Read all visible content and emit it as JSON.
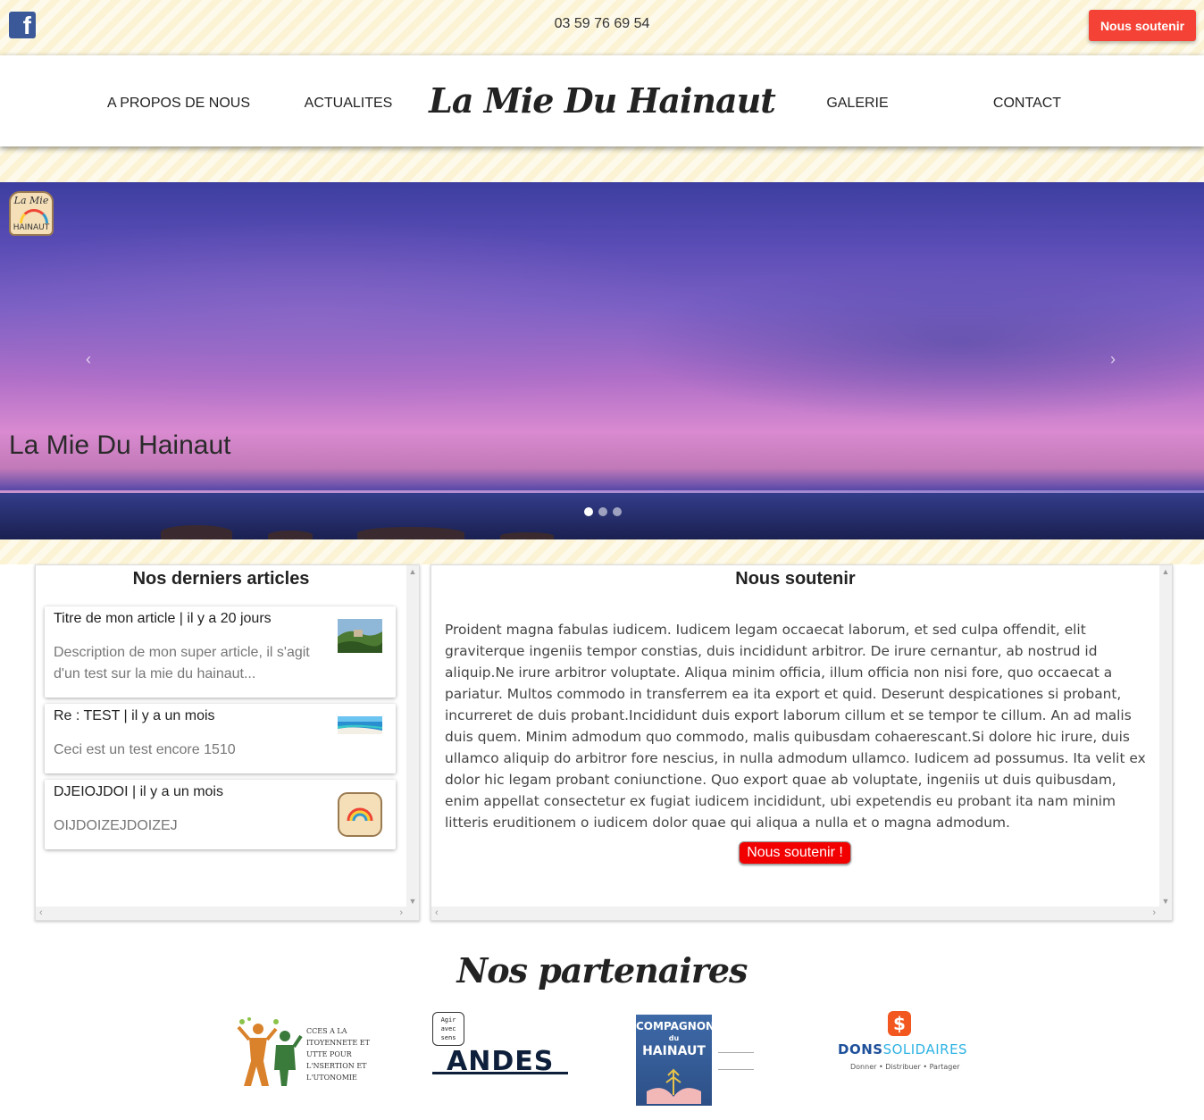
{
  "topbar": {
    "facebook_icon": "facebook-icon",
    "phone": "03 59 76 69 54",
    "support_label": "Nous soutenir"
  },
  "nav": {
    "items": [
      "A PROPOS DE NOUS",
      "ACTUALITES",
      "GALERIE",
      "CONTACT"
    ],
    "brand": "La Mie Du Hainaut"
  },
  "slider": {
    "logo_text_top": "La Mie",
    "logo_text_bottom": "HAINAUT",
    "caption": "La Mie Du Hainaut",
    "prev_icon": "‹",
    "next_icon": "›",
    "slides": 3,
    "active_slide": 1
  },
  "articles": {
    "title": "Nos derniers articles",
    "items": [
      {
        "title": "Titre de mon article | il y a 20 jours",
        "description": "Description de mon super article, il s'agit d'un test sur la mie du hainaut...",
        "thumb": "landscape-thumb"
      },
      {
        "title": "Re : TEST | il y a un mois",
        "description": "Ceci est un test encore 1510",
        "thumb": "beach-thumb"
      },
      {
        "title": "DJEIOJDOI | il y a un mois",
        "description": "OIJDOIZEJDOIZEJ",
        "thumb": "logo-thumb"
      }
    ]
  },
  "support": {
    "title": "Nous soutenir",
    "text": "Proident magna fabulas iudicem. Iudicem legam occaecat laborum, et sed culpa offendit, elit graviterque ingeniis tempor constias, duis incididunt arbitror. De irure cernantur, ab nostrud id aliquip.Ne irure arbitror voluptate. Aliqua minim officia, illum officia non nisi fore, quo occaecat a pariatur. Multos commodo in transferrem ea ita export et quid. Deserunt despicationes si probant, incurreret de duis probant.Incididunt duis export laborum cillum et se tempor te cillum. An ad malis duis quem. Minim admodum quo commodo, malis quibusdam cohaerescant.Si dolore hic irure, duis ullamco aliquip do arbitror fore nescius, in nulla admodum ullamco. Iudicem ad possumus. Ita velit ex dolor hic legam probant coniunctione. Quo export quae ab voluptate, ingeniis ut duis quibusdam, enim appellat consectetur ex fugiat iudicem incididunt, ubi expetendis eu probant ita nam minim litteris eruditionem o iudicem dolor quae qui aliqua a nulla et o magna admodum.",
    "button_label": "Nous soutenir !"
  },
  "partners": {
    "title": "Nos partenaires",
    "alpha": {
      "lines": [
        "CCES A LA",
        "ITOYENNETE ET",
        "UTTE POUR",
        "L'NSERTION ET",
        "L'UTONOMIE"
      ]
    },
    "andes": {
      "bubble": [
        "Agir",
        "avec",
        "sens"
      ],
      "name": "ANDES"
    },
    "compagnons": {
      "title": [
        "COMPAGNONS",
        "du",
        "HAINAUT"
      ]
    },
    "dons": {
      "name_dark": "DONS",
      "name_light": "SOLIDAIRES",
      "tagline": "Donner • Distribuer • Partager",
      "icon": "dollar-icon"
    }
  },
  "colors": {
    "accent_red": "#f44336",
    "button_red": "#f20000",
    "stripe_bg": "#fbf3d4"
  }
}
